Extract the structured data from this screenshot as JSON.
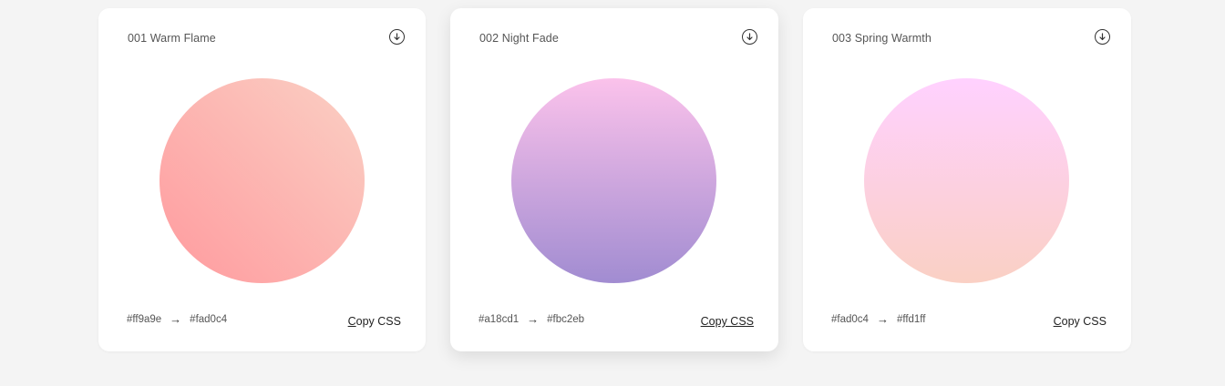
{
  "cards": [
    {
      "title": "001 Warm Flame",
      "color_from": "#ff9a9e",
      "color_to": "#fad0c4",
      "arrow": "→",
      "copy_label_first": "C",
      "copy_label_rest": "opy CSS",
      "gradient": {
        "from": "#ff9a9e",
        "to": "#fad0c4",
        "angle": "45deg"
      }
    },
    {
      "title": "002 Night Fade",
      "color_from": "#a18cd1",
      "color_to": "#fbc2eb",
      "arrow": "→",
      "copy_label": "Copy CSS",
      "gradient": {
        "from": "#a18cd1",
        "to": "#fbc2eb",
        "angle": "0deg"
      }
    },
    {
      "title": "003 Spring Warmth",
      "color_from": "#fad0c4",
      "color_to": "#ffd1ff",
      "arrow": "→",
      "copy_label_first": "C",
      "copy_label_rest": "opy CSS",
      "gradient": {
        "from": "#fad0c4",
        "to": "#ffd1ff",
        "angle": "0deg"
      }
    }
  ],
  "colors": {
    "page_bg": "#f4f4f4",
    "card_bg": "#ffffff",
    "text": "#555555"
  }
}
